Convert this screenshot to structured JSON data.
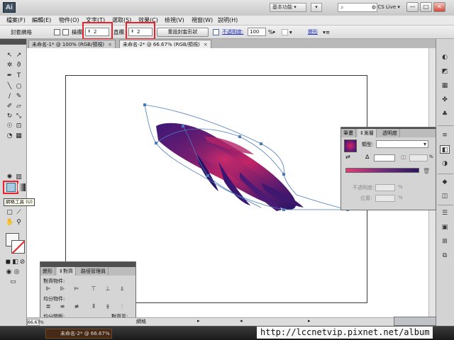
{
  "titlebar": {
    "app_logo": "Ai",
    "workspace": "基本功能",
    "live_label": "CS Live",
    "controls": [
      "—",
      "□",
      "✕"
    ]
  },
  "menubar": [
    "檔案(F)",
    "編輯(E)",
    "物件(O)",
    "文字(T)",
    "選取(S)",
    "效果(C)",
    "檢視(V)",
    "視窗(W)",
    "說明(H)"
  ],
  "control": {
    "selection_type": "封套網格",
    "rows_label": "橫欄",
    "rows_value": "2",
    "columns_label": "直欄",
    "columns_value": "2",
    "reset_button": "重設封套形狀",
    "opacity_label": "不透明度:",
    "opacity_value": "100",
    "opacity_unit": "%",
    "transform_label": "變形"
  },
  "tabs": [
    {
      "label": "未命名-1* @ 100% (RGB/預視)",
      "close": "×"
    },
    {
      "label": "未命名-2* @ 66.67% (RGB/預視)",
      "close": "×"
    }
  ],
  "toolbox": {
    "tooltip": "網格工具 (U)",
    "selected_tool": "mesh-tool"
  },
  "gradient_panel": {
    "tabs": [
      "筆畫",
      "漸層",
      "透明度"
    ],
    "active_tab": "漸層",
    "type_label": "類型:",
    "type_value": "",
    "percent_sign": "%",
    "opacity_label": "不透明度:",
    "location_label": "位置:",
    "colors": {
      "start": "#e43a76",
      "mid": "#6a2b7b",
      "end": "#2d1660"
    }
  },
  "align_panel": {
    "tabs": [
      "變形",
      "對齊",
      "路徑管理員"
    ],
    "active_tab": "對齊",
    "align_objects": "對齊物件:",
    "distribute_objects": "均分物件:",
    "distribute_spacing": "均分間距:",
    "align_to": "對齊至:"
  },
  "status": {
    "zoom": "66.67%",
    "text": "網格"
  },
  "taskbar": {
    "item": "未命名-2* @ 66.67%"
  },
  "watermark": "http://lccnetvip.pixnet.net/album",
  "accent_color": "#e8232b"
}
